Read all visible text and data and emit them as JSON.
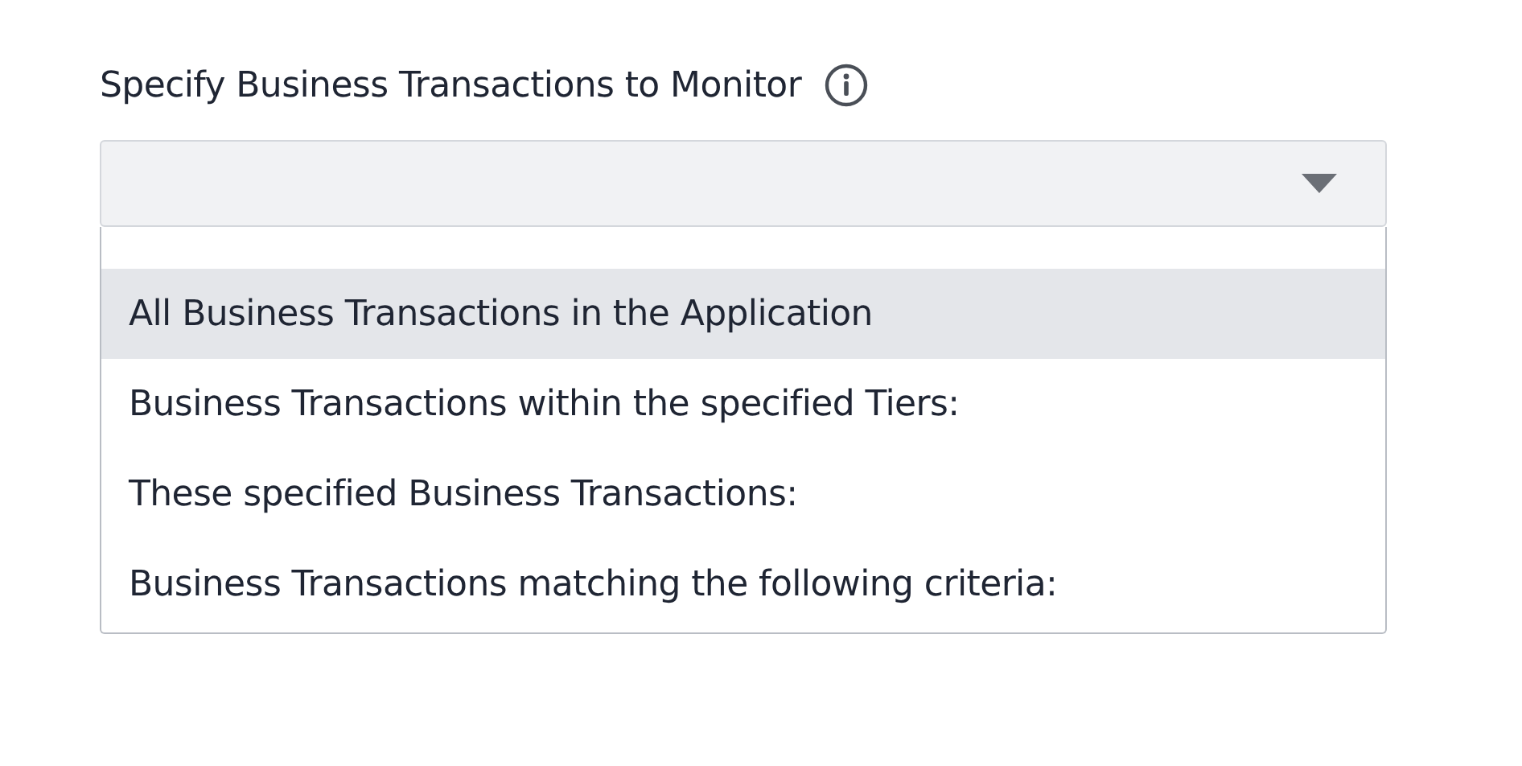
{
  "field": {
    "label": "Specify Business Transactions to Monitor",
    "info": true
  },
  "dropdown": {
    "expanded": true,
    "options": [
      {
        "label": "All Business Transactions in the Application",
        "selected": true
      },
      {
        "label": "Business Transactions within the specified Tiers:",
        "selected": false
      },
      {
        "label": "These specified Business Transactions:",
        "selected": false
      },
      {
        "label": "Business Transactions matching the following criteria:",
        "selected": false
      }
    ]
  }
}
